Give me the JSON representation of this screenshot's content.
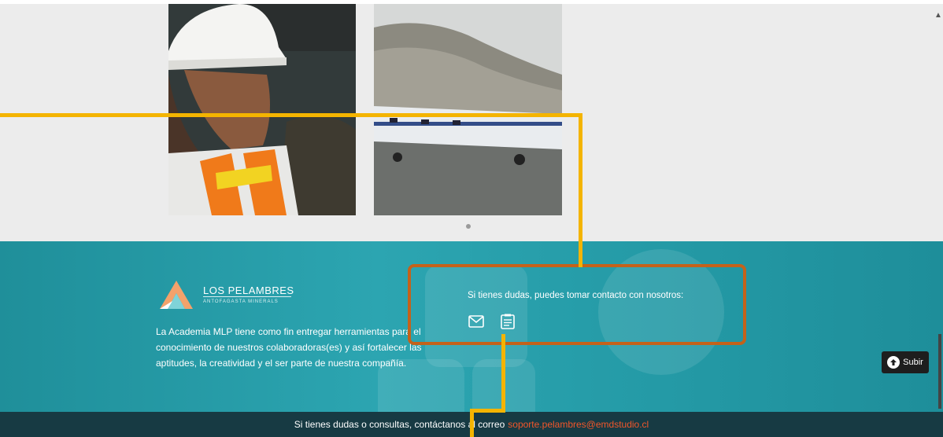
{
  "gallery": {
    "image1_alt": "worker-with-helmet",
    "image2_alt": "airplane-on-runway"
  },
  "footer": {
    "logo_title": "LOS PELAMBRES",
    "logo_subtitle": "ANTOFAGASTA MINERALS",
    "about_text": "La Academia MLP tiene como fin entregar herramientas para el conocimiento de nuestros colaboradoras(es) y así fortalecer las aptitudes, la creatividad y el ser parte de nuestra compañía.",
    "contact_text": "Si tienes dudas, puedes tomar contacto con nosotros:",
    "icons": {
      "email": "envelope-icon",
      "form": "form-icon"
    },
    "subir_label": "Subir"
  },
  "bottom_bar": {
    "text": "Si tienes dudas o consultas, contáctanos al correo",
    "email": "soporte.pelambres@emdstudio.cl"
  },
  "colors": {
    "teal": "#2ca5b1",
    "bottom_bar": "#173a43",
    "highlight_box": "#c4621a",
    "connector": "#f4b400",
    "email_link": "#f2562a"
  }
}
